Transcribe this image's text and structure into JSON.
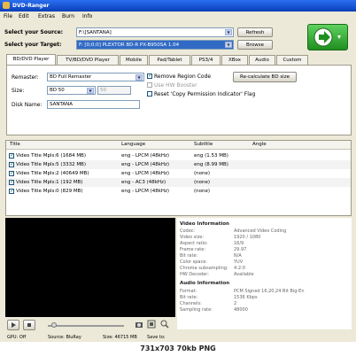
{
  "window": {
    "title": "DVD-Ranger"
  },
  "menu": [
    "File",
    "Edit",
    "Extras",
    "Burn",
    "Info"
  ],
  "source": {
    "label": "Select your Source:",
    "value": "F:\\[SANTANA]",
    "browse_label": "Browse"
  },
  "target": {
    "label": "Select your Target:",
    "value": "F: [0;0;0] PLEXTOR BD-R  PX-B950SA 1.04",
    "refresh_label": "Refresh"
  },
  "tabs": [
    "BD/DVD Player",
    "TV/BD/DVD Player",
    "Mobile",
    "Pad/Tablet",
    "PS3/4",
    "XBox",
    "Audio",
    "Custom"
  ],
  "settings": {
    "remaster_label": "Remaster:",
    "remaster_value": "BD Full Remaster",
    "size_label": "Size:",
    "size_value": "BD 50",
    "size_extra": "50",
    "diskname_label": "Disk Name:",
    "diskname_value": "SANTANA",
    "remove_region": "Remove Region Code",
    "hw_booster": "Use HW Booster",
    "reset_copy": "Reset 'Copy Permission Indicator' Flag",
    "recalc_label": "Re-calculate BD size"
  },
  "table": {
    "headers": [
      "Title",
      "Language",
      "Subtitle",
      "Angle"
    ],
    "rows": [
      {
        "title": "Video Title  Mpls:6 (1684 MB)",
        "language": "eng - LPCM (48kHz)",
        "subtitle": "eng (1.53 MB)"
      },
      {
        "title": "Video Title  Mpls:5 (3332 MB)",
        "language": "eng - LPCM (48kHz)",
        "subtitle": "eng (8.99 MB)"
      },
      {
        "title": "Video Title  Mpls:2 (40649 MB)",
        "language": "eng - LPCM (48kHz)",
        "subtitle": "(none)"
      },
      {
        "title": "Video Title  Mpls:1 (192 MB)",
        "language": "eng - AC3 (48kHz)",
        "subtitle": "(none)"
      },
      {
        "title": "Video Title  Mpls:0 (829 MB)",
        "language": "eng - LPCM (48kHz)",
        "subtitle": "(none)"
      }
    ]
  },
  "video_info": {
    "heading": "Video Information",
    "items": [
      {
        "k": "Codec:",
        "v": "Advanced Video Coding"
      },
      {
        "k": "Video size:",
        "v": "1920 / 1080"
      },
      {
        "k": "Aspect ratio:",
        "v": "16/9"
      },
      {
        "k": "Frame rate:",
        "v": "29.97"
      },
      {
        "k": "Bit rate:",
        "v": "N/A"
      },
      {
        "k": "Color space:",
        "v": "YUV"
      },
      {
        "k": "Chroma subsampling:",
        "v": "4:2:0"
      },
      {
        "k": "HW Decoder:",
        "v": "Available"
      }
    ]
  },
  "audio_info": {
    "heading": "Audio Information",
    "items": [
      {
        "k": "Format:",
        "v": "PCM Signed 16,20,24 Bit Big-En"
      },
      {
        "k": "Bit rate:",
        "v": "1536 Kbps"
      },
      {
        "k": "Channels:",
        "v": "2"
      },
      {
        "k": "Sampling rate:",
        "v": "48000"
      }
    ]
  },
  "status": {
    "gpu": "GPU: Off",
    "source": "Source: BluRay",
    "size": "Size: 46715 MB",
    "save": "Save to:"
  },
  "caption": "731x703  70kb  PNG",
  "colors": {
    "titlebar": "#0a3fb8",
    "go_button": "#2ea82e",
    "selection": "#316ac5"
  }
}
